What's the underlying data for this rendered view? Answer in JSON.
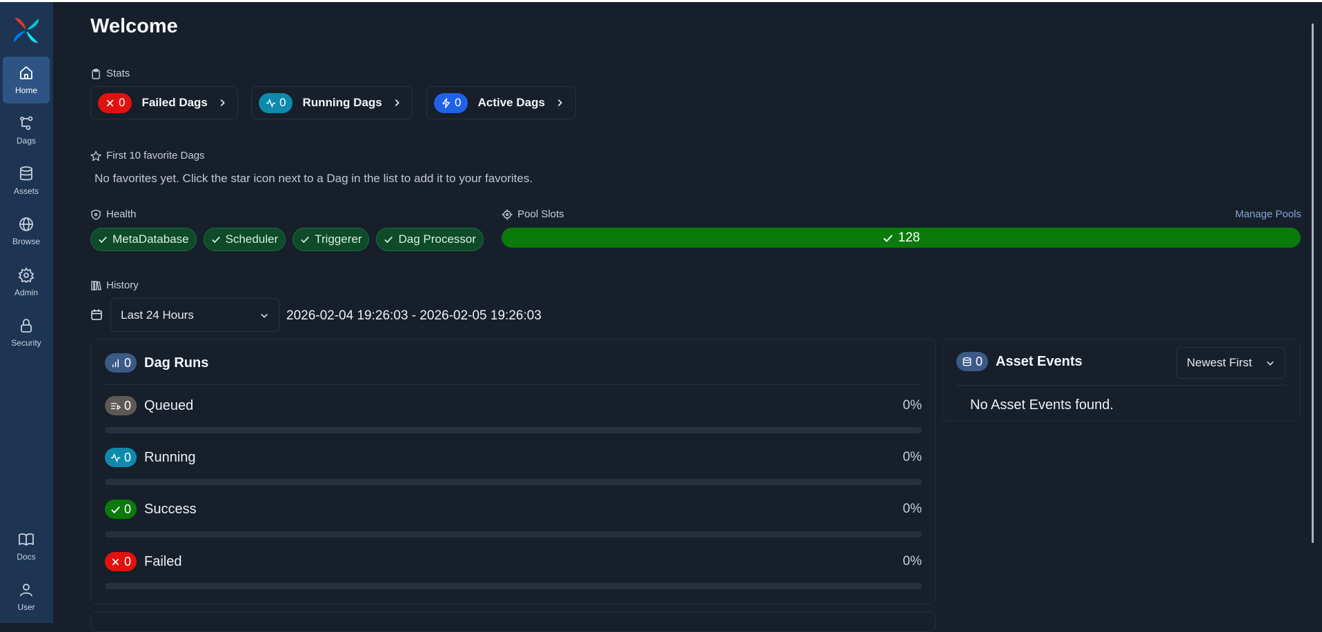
{
  "page_title": "Welcome",
  "sidebar": {
    "items": [
      {
        "label": "Home",
        "icon": "home-icon",
        "active": true
      },
      {
        "label": "Dags",
        "icon": "dags-icon"
      },
      {
        "label": "Assets",
        "icon": "database-icon"
      },
      {
        "label": "Browse",
        "icon": "globe-icon"
      },
      {
        "label": "Admin",
        "icon": "gear-icon"
      },
      {
        "label": "Security",
        "icon": "lock-icon"
      }
    ],
    "bottom_items": [
      {
        "label": "Docs",
        "icon": "book-icon"
      },
      {
        "label": "User",
        "icon": "user-icon"
      }
    ]
  },
  "stats": {
    "label": "Stats",
    "cards": [
      {
        "count": "0",
        "title": "Failed Dags",
        "color": "#e0120f"
      },
      {
        "count": "0",
        "title": "Running Dags",
        "color": "#0e8aad"
      },
      {
        "count": "0",
        "title": "Active Dags",
        "color": "#1f62e8"
      }
    ]
  },
  "favorites": {
    "label": "First 10 favorite Dags",
    "empty_text": "No favorites yet. Click the star icon next to a Dag in the list to add it to your favorites."
  },
  "health": {
    "label": "Health",
    "items": [
      "MetaDatabase",
      "Scheduler",
      "Triggerer",
      "Dag Processor"
    ]
  },
  "pool_slots": {
    "label": "Pool Slots",
    "manage_link": "Manage Pools",
    "value": "128",
    "color": "#0a7a0a"
  },
  "history": {
    "label": "History",
    "range_select": "Last 24 Hours",
    "date_range": "2026-02-04 19:26:03 - 2026-02-05 19:26:03"
  },
  "dag_runs": {
    "title": "Dag Runs",
    "count": "0",
    "states": [
      {
        "label": "Queued",
        "count": "0",
        "pct": "0%",
        "fraction": 0,
        "color": "#5d5954"
      },
      {
        "label": "Running",
        "count": "0",
        "pct": "0%",
        "fraction": 0,
        "color": "#0e8aad"
      },
      {
        "label": "Success",
        "count": "0",
        "pct": "0%",
        "fraction": 0,
        "color": "#0a7a0a"
      },
      {
        "label": "Failed",
        "count": "0",
        "pct": "0%",
        "fraction": 0,
        "color": "#e0120f"
      }
    ]
  },
  "asset_events": {
    "title": "Asset Events",
    "count": "0",
    "sort_select": "Newest First",
    "empty_text": "No Asset Events found."
  }
}
